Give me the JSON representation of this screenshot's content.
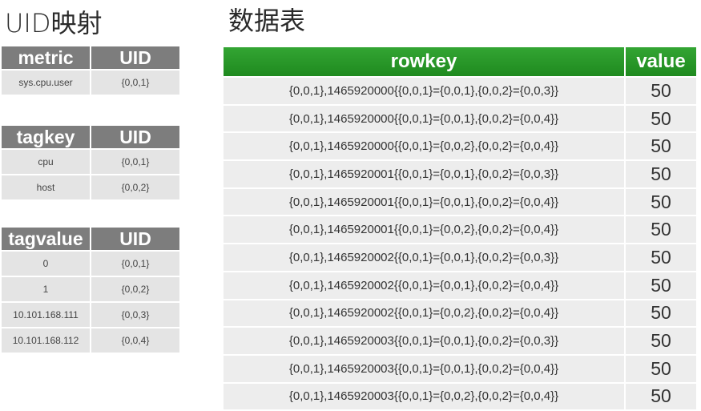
{
  "left_title": "UID映射",
  "right_title": "数据表",
  "metric_table": {
    "headers": [
      "metric",
      "UID"
    ],
    "rows": [
      [
        "sys.cpu.user",
        "{0,0,1}"
      ]
    ]
  },
  "tagkey_table": {
    "headers": [
      "tagkey",
      "UID"
    ],
    "rows": [
      [
        "cpu",
        "{0,0,1}"
      ],
      [
        "host",
        "{0,0,2}"
      ]
    ]
  },
  "tagvalue_table": {
    "headers": [
      "tagvalue",
      "UID"
    ],
    "rows": [
      [
        "0",
        "{0,0,1}"
      ],
      [
        "1",
        "{0,0,2}"
      ],
      [
        "10.101.168.111",
        "{0,0,3}"
      ],
      [
        "10.101.168.112",
        "{0,0,4}"
      ]
    ]
  },
  "data_table": {
    "headers": [
      "rowkey",
      "value"
    ],
    "rows": [
      [
        "{0,0,1},1465920000{{0,0,1}={0,0,1},{0,0,2}={0,0,3}}",
        "50"
      ],
      [
        "{0,0,1},1465920000{{0,0,1}={0,0,1},{0,0,2}={0,0,4}}",
        "50"
      ],
      [
        "{0,0,1},1465920000{{0,0,1}={0,0,2},{0,0,2}={0,0,4}}",
        "50"
      ],
      [
        "{0,0,1},1465920001{{0,0,1}={0,0,1},{0,0,2}={0,0,3}}",
        "50"
      ],
      [
        "{0,0,1},1465920001{{0,0,1}={0,0,1},{0,0,2}={0,0,4}}",
        "50"
      ],
      [
        "{0,0,1},1465920001{{0,0,1}={0,0,2},{0,0,2}={0,0,4}}",
        "50"
      ],
      [
        "{0,0,1},1465920002{{0,0,1}={0,0,1},{0,0,2}={0,0,3}}",
        "50"
      ],
      [
        "{0,0,1},1465920002{{0,0,1}={0,0,1},{0,0,2}={0,0,4}}",
        "50"
      ],
      [
        "{0,0,1},1465920002{{0,0,1}={0,0,2},{0,0,2}={0,0,4}}",
        "50"
      ],
      [
        "{0,0,1},1465920003{{0,0,1}={0,0,1},{0,0,2}={0,0,3}}",
        "50"
      ],
      [
        "{0,0,1},1465920003{{0,0,1}={0,0,1},{0,0,2}={0,0,4}}",
        "50"
      ],
      [
        "{0,0,1},1465920003{{0,0,1}={0,0,2},{0,0,2}={0,0,4}}",
        "50"
      ]
    ]
  },
  "colors": {
    "header_gray": "#7d7d7d",
    "header_green": "#2a9a2a",
    "cell_bg": "#e4e4e4"
  }
}
